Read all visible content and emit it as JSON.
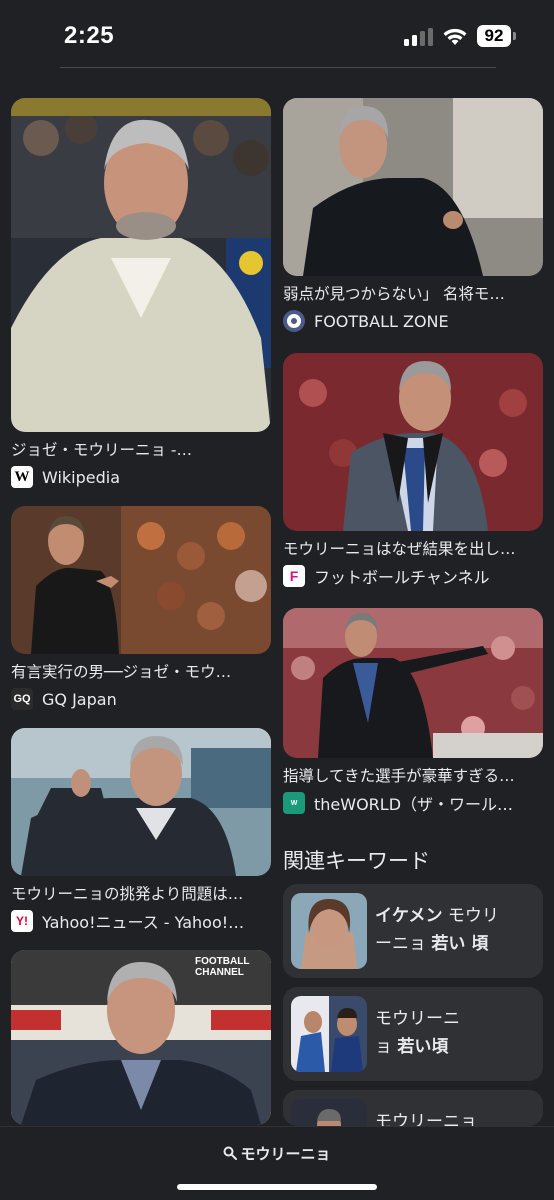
{
  "status_bar": {
    "time": "2:25",
    "battery": "92"
  },
  "left_column": [
    {
      "caption": "ジョゼ・モウリーニョ -…",
      "source": "Wikipedia",
      "icon_text": "W",
      "icon_name": "wikipedia-icon"
    },
    {
      "caption": "有言実行の男──ジョゼ・モウ…",
      "source": "GQ Japan",
      "icon_text": "GQ",
      "icon_name": "gq-japan-icon"
    },
    {
      "caption": "モウリーニョの挑発より問題は…",
      "source": "Yahoo!ニュース - Yahoo!…",
      "icon_text": "Y!",
      "icon_name": "yahoo-icon"
    },
    {
      "caption": "",
      "source": "",
      "overlay": "FOOTBALL CHANNEL"
    }
  ],
  "right_column": [
    {
      "caption": "弱点が見つからない」 名将モ…",
      "source": "FOOTBALL ZONE",
      "icon_name": "football-zone-icon"
    },
    {
      "caption": "モウリーニョはなぜ結果を出し…",
      "source": "フットボールチャンネル",
      "icon_text": "F",
      "icon_name": "football-channel-icon"
    },
    {
      "caption": "指導してきた選手が豪華すぎる…",
      "source": "theWORLD（ザ・ワール…",
      "icon_text": "W",
      "icon_name": "theworld-icon"
    }
  ],
  "related": {
    "title": "関連キーワード",
    "items": [
      {
        "bold1": "イケメン",
        "text1": " モウリ",
        "text2": "ーニョ ",
        "bold2": "若い 頃"
      },
      {
        "text1": "モウリーニ",
        "text2": "ョ ",
        "bold2": "若い頃"
      },
      {
        "text1": "モウリーニョ"
      }
    ]
  },
  "bottom_bar": {
    "search_query": "モウリーニョ"
  },
  "colors": {
    "background": "#202124",
    "card": "#303134",
    "text": "#e8eaed"
  }
}
